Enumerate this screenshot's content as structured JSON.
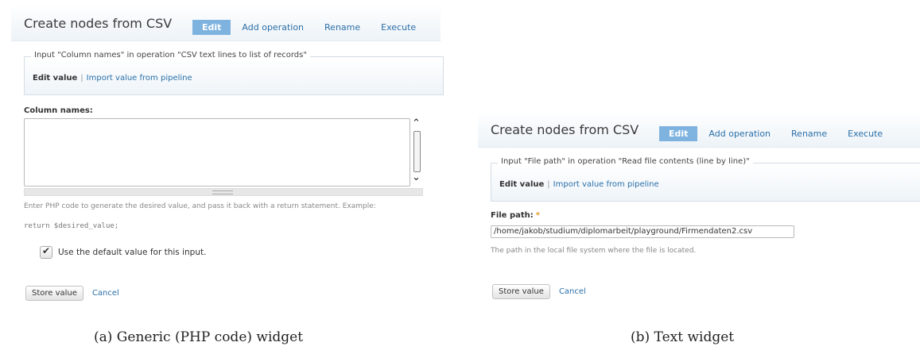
{
  "panels": {
    "generic": {
      "title": "Create nodes from CSV",
      "tabs": [
        "Edit",
        "Add operation",
        "Rename",
        "Execute"
      ],
      "fieldset_legend": "Input \"Column names\" in operation \"CSV text lines to list of records\"",
      "edit_value": "Edit value",
      "separator": "|",
      "import_value": "Import value from pipeline",
      "field_label": "Column names:",
      "textarea_value": "",
      "description": "Enter PHP code to generate the desired value, and pass it back with a return statement. Example:",
      "code_example": "return $desired_value;",
      "checkbox_label": "Use the default value for this input.",
      "checkbox_checked": true,
      "store_button": "Store value",
      "cancel_link": "Cancel"
    },
    "text": {
      "title": "Create nodes from CSV",
      "tabs": [
        "Edit",
        "Add operation",
        "Rename",
        "Execute"
      ],
      "fieldset_legend": "Input \"File path\" in operation \"Read file contents (line by line)\"",
      "edit_value": "Edit value",
      "separator": "|",
      "import_value": "Import value from pipeline",
      "field_label": "File path:",
      "required_mark": "*",
      "input_value": "/home/jakob/studium/diplomarbeit/playground/Firmendaten2.csv",
      "description": "The path in the local file system where the file is located.",
      "store_button": "Store value",
      "cancel_link": "Cancel"
    }
  },
  "captions": {
    "a": "(a) Generic (PHP code) widget",
    "b": "(b) Text widget"
  },
  "icons": {
    "scroll_up": "chevron-up-icon",
    "scroll_down": "chevron-down-icon",
    "checkmark": "checkmark-icon"
  },
  "colors": {
    "tab_active_bg": "#7fb3df",
    "link": "#2a6fa8",
    "required": "#e09a26"
  }
}
